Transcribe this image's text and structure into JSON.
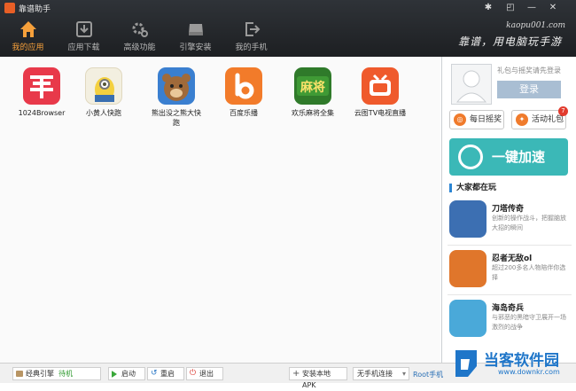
{
  "window": {
    "title": "靠谱助手",
    "url": "kaopu001.com",
    "slogan": "靠谱，用电脑玩手游"
  },
  "nav": [
    {
      "label": "我的应用",
      "icon": "home-icon",
      "active": true
    },
    {
      "label": "应用下载",
      "icon": "download-icon",
      "active": false
    },
    {
      "label": "高级功能",
      "icon": "gears-icon",
      "active": false
    },
    {
      "label": "引擎安装",
      "icon": "disk-icon",
      "active": false
    },
    {
      "label": "我的手机",
      "icon": "export-phone-icon",
      "active": false
    }
  ],
  "apps": [
    {
      "name": "1024Browser",
      "icon": "browser-icon",
      "color": "#e8394a"
    },
    {
      "name": "小黄人快跑",
      "icon": "minion-icon",
      "color": "#f4d03f"
    },
    {
      "name": "熊出没之熊大快跑",
      "icon": "bear-icon",
      "color": "#3a7fd0"
    },
    {
      "name": "百度乐播",
      "icon": "baidu-play-icon",
      "color": "#f27b2a"
    },
    {
      "name": "欢乐麻将全集",
      "icon": "mahjong-icon",
      "color": "#2f7a2a"
    },
    {
      "name": "云图TV电视直播",
      "icon": "tv-icon",
      "color": "#ef5a2c"
    }
  ],
  "sidebar": {
    "login_tip": "礼包与摇奖请先登录",
    "login_button": "登录",
    "daily_lottery": "每日摇奖",
    "gift_button": "活动礼包",
    "gift_badge": "7",
    "speed_button": "一键加速",
    "section_title": "大家都在玩",
    "games": [
      {
        "name": "刀塔传奇",
        "desc": "创新的操作战斗，把握脑放大招的瞬间",
        "color": "#3c6fb2"
      },
      {
        "name": "忍者无敌ol",
        "desc": "超过200多名人物陪伴你选择",
        "color": "#e0762b"
      },
      {
        "name": "海岛奇兵",
        "desc": "与邪恶的黑暗守卫展开一场激烈的战争",
        "color": "#4aa9d9"
      }
    ]
  },
  "statusbar": {
    "engine_label": "经典引擎",
    "engine_status": "待机",
    "start": "启动",
    "restart": "重启",
    "quit": "退出",
    "install_apk": "安装本地APK",
    "phone_select": "无手机连接",
    "root_link": "Root手机"
  },
  "watermark": {
    "text": "当客软件园",
    "url": "www.downkr.com"
  },
  "colors": {
    "header": "#24272b",
    "accent_orange": "#f6a03b",
    "speed_teal": "#3bb8b7",
    "login": "#a9bed3"
  }
}
